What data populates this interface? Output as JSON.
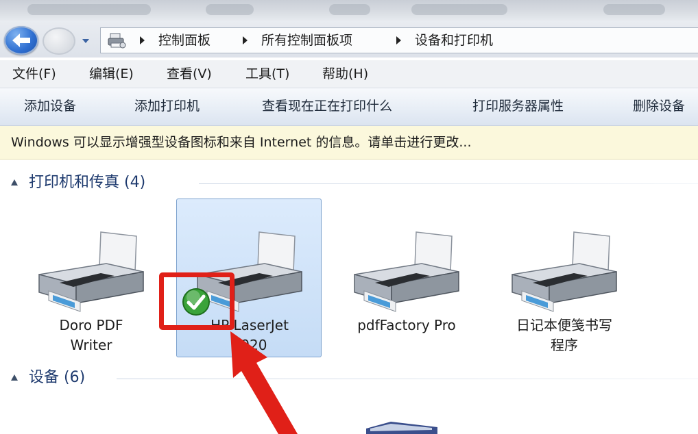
{
  "window": {
    "address": {
      "crumbs": [
        "控制面板",
        "所有控制面板项",
        "设备和打印机"
      ]
    }
  },
  "menubar": {
    "items": [
      "文件(F)",
      "编辑(E)",
      "查看(V)",
      "工具(T)",
      "帮助(H)"
    ]
  },
  "commandbar": {
    "items": [
      "添加设备",
      "添加打印机",
      "查看现在正在打印什么",
      "打印服务器属性",
      "删除设备"
    ]
  },
  "infobar": {
    "text": "Windows 可以显示增强型设备图标和来自 Internet 的信息。请单击进行更改..."
  },
  "groups": {
    "printers": {
      "title": "打印机和传真 (4)",
      "items": [
        {
          "line1": "Doro PDF",
          "line2": "Writer"
        },
        {
          "line1": "HP LaserJet",
          "line2": "1020"
        },
        {
          "line1": "pdfFactory Pro",
          "line2": ""
        },
        {
          "line1": "日记本便笺书写",
          "line2": "程序"
        }
      ]
    },
    "devices": {
      "title": "设备 (6)"
    }
  },
  "icons": {
    "back": "back-arrow-icon",
    "forward": "forward-icon",
    "history": "chevron-down-icon",
    "address": "devices-printers-icon",
    "printer": "printer-icon",
    "default": "checkmark-icon",
    "annotation": "red-arrow-icon"
  },
  "colors": {
    "selection": "#c5dcf6",
    "group_title": "#1e3a6e",
    "infobar": "#fbf8dc",
    "annotation_red": "#e02018",
    "default_badge": "#3aa33a"
  }
}
